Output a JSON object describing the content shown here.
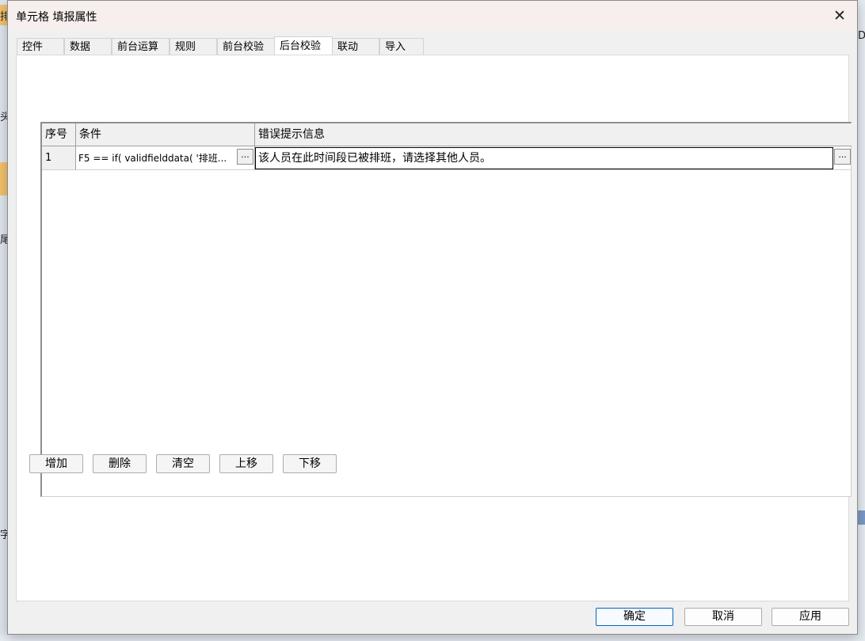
{
  "dialog": {
    "title": "单元格 填报属性",
    "close_glyph": "✕"
  },
  "tabs": [
    {
      "label": "控件"
    },
    {
      "label": "数据"
    },
    {
      "label": "前台运算"
    },
    {
      "label": "规则"
    },
    {
      "label": "前台校验"
    },
    {
      "label": "后台校验",
      "active": true
    },
    {
      "label": "联动"
    },
    {
      "label": "导入"
    }
  ],
  "grid": {
    "columns": {
      "seq": "序号",
      "condition": "条件",
      "message": "错误提示信息"
    },
    "rows": [
      {
        "seq": "1",
        "condition": "F5 == if(  validfielddata(   '排班...",
        "message": "该人员在此时间段已被排班，请选择其他人员。"
      }
    ],
    "ellipsis": "..."
  },
  "actions": {
    "add": "增加",
    "delete": "删除",
    "clear": "清空",
    "move_up": "上移",
    "move_down": "下移"
  },
  "footer": {
    "ok": "确定",
    "cancel": "取消",
    "apply": "应用"
  },
  "background": {
    "frag_top_left": "排",
    "frag_left_1": "头",
    "frag_left_2": "尾",
    "frag_left_3": "字",
    "frag_top_right": "D"
  },
  "colors": {
    "title_bar": "#f7eeee",
    "primary_border": "#0067c0",
    "dialog_bg": "#f0f0f0"
  }
}
